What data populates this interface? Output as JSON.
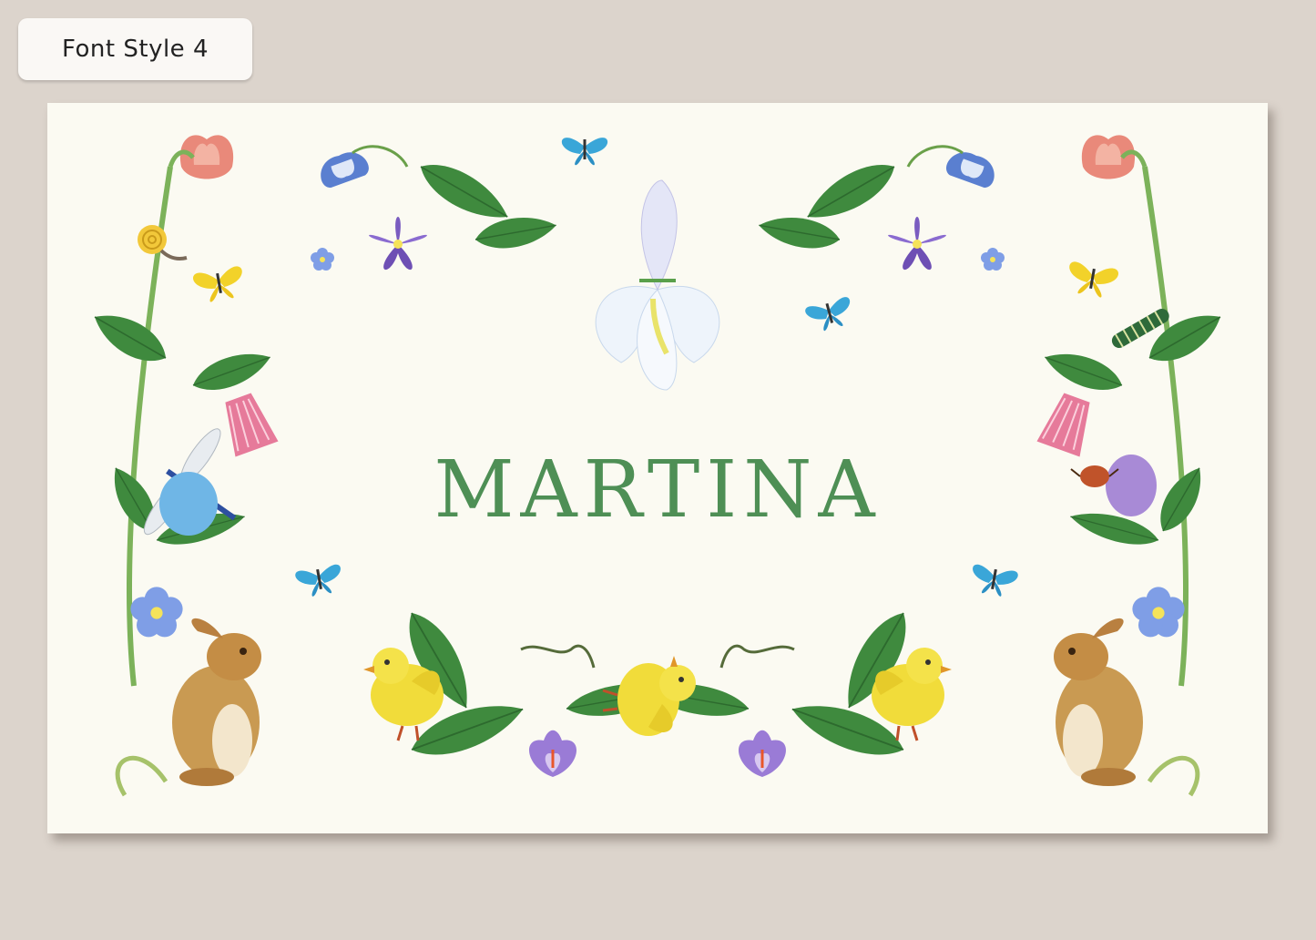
{
  "badge": {
    "label": "Font Style 4"
  },
  "card": {
    "name": "MARTINA",
    "name_color": "#4e8f55",
    "background": "#fbfaf2"
  },
  "illustrations": [
    "tulip-icon",
    "bellflower-icon",
    "iris-icon",
    "violet-orchid-icon",
    "forget-me-not-icon",
    "butterfly-icon",
    "snail-icon",
    "dragonfly-icon",
    "caterpillar-icon",
    "beetle-icon",
    "easter-egg-icon",
    "rabbit-icon",
    "chick-icon",
    "crocus-icon",
    "leaf-icon"
  ]
}
